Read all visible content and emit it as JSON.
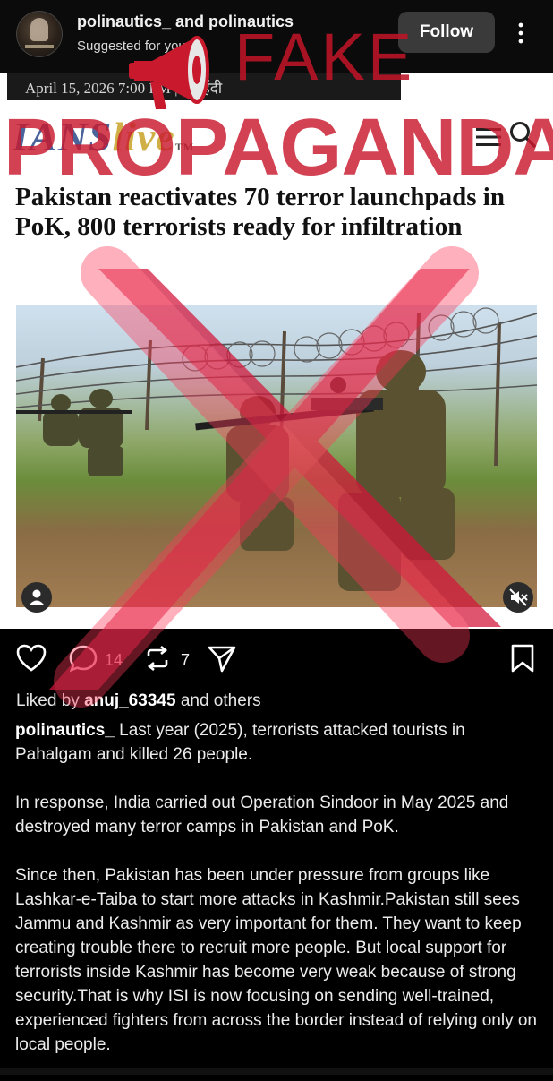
{
  "post": {
    "username": "polinautics_ and polinautics",
    "suggested": "Suggested for you",
    "follow_label": "Follow"
  },
  "article": {
    "date": "April 15, 2026 7:00 PM | ⟳ हिंदी",
    "logo_a": "IANS",
    "logo_b": "live",
    "logo_tm": "TM",
    "headline": "Pakistan reactivates 70 terror launchpads in PoK, 800 terrorists ready for infiltration"
  },
  "overlay": {
    "fake": "FAKE",
    "propaganda": "PROPAGANDA",
    "color": "#c8192d"
  },
  "actions": {
    "comments": "14",
    "reposts": "7"
  },
  "likes": {
    "prefix": "Liked by",
    "user": "anuj_63345",
    "suffix": "and others"
  },
  "caption": {
    "user": "polinautics_",
    "p1": "Last year (2025), terrorists attacked tourists in Pahalgam and killed 26 people.",
    "p2": "In response, India carried out Operation Sindoor in May 2025 and destroyed many terror camps in Pakistan and PoK.",
    "p3": "Since then, Pakistan has been under pressure from groups like Lashkar-e-Taiba to start more attacks in Kashmir.Pakistan still sees Jammu and Kashmir as very important for them. They want to keep creating trouble there to recruit more people. But local support for terrorists inside Kashmir has become very weak because of strong security.That is why ISI is now focusing on sending well-trained, experienced fighters from across the border instead of relying only on local people."
  }
}
